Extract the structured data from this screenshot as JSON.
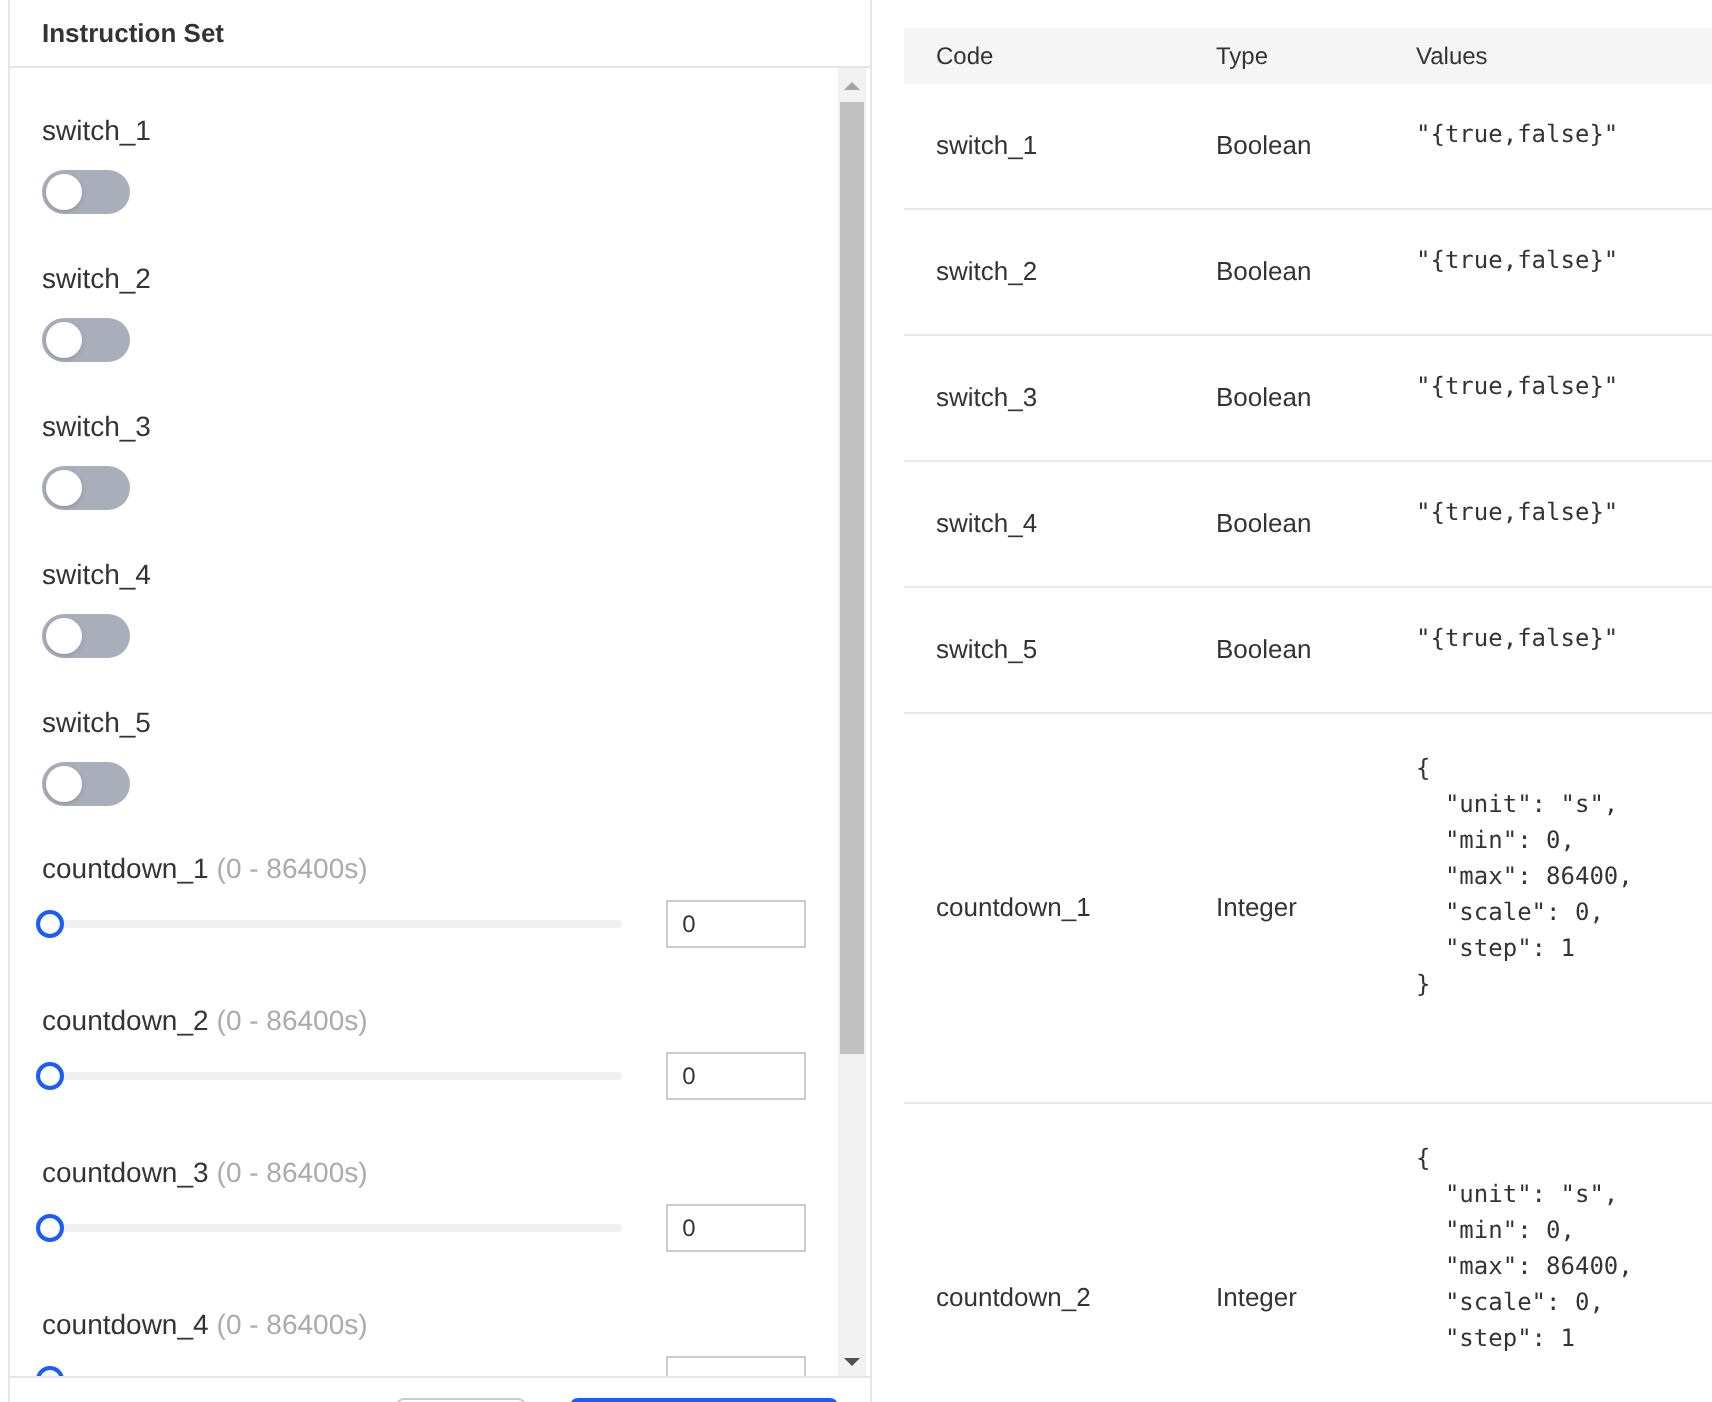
{
  "panel": {
    "title": "Instruction Set"
  },
  "controls": [
    {
      "kind": "switch",
      "label": "switch_1",
      "on": false
    },
    {
      "kind": "switch",
      "label": "switch_2",
      "on": false
    },
    {
      "kind": "switch",
      "label": "switch_3",
      "on": false
    },
    {
      "kind": "switch",
      "label": "switch_4",
      "on": false
    },
    {
      "kind": "switch",
      "label": "switch_5",
      "on": false
    },
    {
      "kind": "slider",
      "label": "countdown_1",
      "range": "(0 - 86400s)",
      "level": 0,
      "value": "0"
    },
    {
      "kind": "slider",
      "label": "countdown_2",
      "range": "(0 - 86400s)",
      "level": 0,
      "value": "0"
    },
    {
      "kind": "slider",
      "label": "countdown_3",
      "range": "(0 - 86400s)",
      "level": 0,
      "value": "0"
    },
    {
      "kind": "slider",
      "label": "countdown_4",
      "range": "(0 - 86400s)",
      "level": 0
    }
  ],
  "table": {
    "columns": [
      "Code",
      "Type",
      "Values"
    ],
    "rows": [
      {
        "code": "switch_1",
        "type": "Boolean",
        "values": "\"{true,false}\""
      },
      {
        "code": "switch_2",
        "type": "Boolean",
        "values": "\"{true,false}\""
      },
      {
        "code": "switch_3",
        "type": "Boolean",
        "values": "\"{true,false}\""
      },
      {
        "code": "switch_4",
        "type": "Boolean",
        "values": "\"{true,false}\""
      },
      {
        "code": "switch_5",
        "type": "Boolean",
        "values": "\"{true,false}\""
      },
      {
        "code": "countdown_1",
        "type": "Integer",
        "values": "{\n  \"unit\": \"s\",\n  \"min\": 0,\n  \"max\": 86400,\n  \"scale\": 0,\n  \"step\": 1\n}"
      },
      {
        "code": "countdown_2",
        "type": "Integer",
        "values": "{\n  \"unit\": \"s\",\n  \"min\": 0,\n  \"max\": 86400,\n  \"scale\": 0,\n  \"step\": 1"
      }
    ]
  }
}
